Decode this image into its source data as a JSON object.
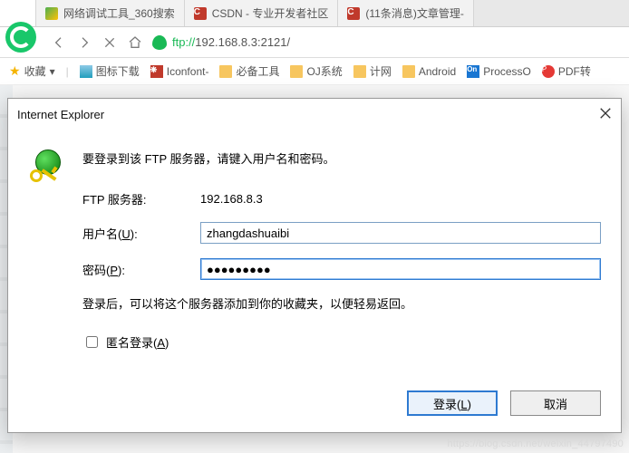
{
  "tabs": [
    {
      "title": "网络调试工具_360搜索",
      "fav": "fav360"
    },
    {
      "title": "CSDN - 专业开发者社区",
      "fav": "favC",
      "favLetter": "C"
    },
    {
      "title": "(11条消息)文章管理-",
      "fav": "favC",
      "favLetter": "C"
    }
  ],
  "url": {
    "proto": "ftp://",
    "rest": "192.168.8.3:2121/"
  },
  "bookmarks": {
    "favLabel": "收藏",
    "items": [
      {
        "label": "图标下载",
        "iconClass": "bm-img"
      },
      {
        "label": "Iconfont-",
        "iconClass": "redC",
        "letter": "❋"
      },
      {
        "label": "必备工具",
        "iconClass": "folder"
      },
      {
        "label": "OJ系统",
        "iconClass": "folder"
      },
      {
        "label": "计网",
        "iconClass": "folder"
      },
      {
        "label": "Android",
        "iconClass": "folder"
      },
      {
        "label": "ProcessO",
        "iconClass": "blueOn",
        "letter": "On"
      },
      {
        "label": "PDF转",
        "iconClass": "pdfI",
        "letter": "P"
      }
    ]
  },
  "dialog": {
    "title": "Internet Explorer",
    "prompt": "要登录到该 FTP 服务器，请键入用户名和密码。",
    "serverLabel": "FTP 服务器:",
    "serverValue": "192.168.8.3",
    "userLabelPrefix": "用户名(",
    "userHotkey": "U",
    "userLabelSuffix": "):",
    "userValue": "zhangdashuaibi",
    "passLabelPrefix": "密码(",
    "passHotkey": "P",
    "passLabelSuffix": "):",
    "passValue": "●●●●●●●●●",
    "note": "登录后，可以将这个服务器添加到你的收藏夹，以便轻易返回。",
    "anonPrefix": "匿名登录(",
    "anonHotkey": "A",
    "anonSuffix": ")",
    "loginPrefix": "登录(",
    "loginHotkey": "L",
    "loginSuffix": ")",
    "cancel": "取消"
  },
  "watermark": "https://blog.csdn.net/weixin_44797490"
}
